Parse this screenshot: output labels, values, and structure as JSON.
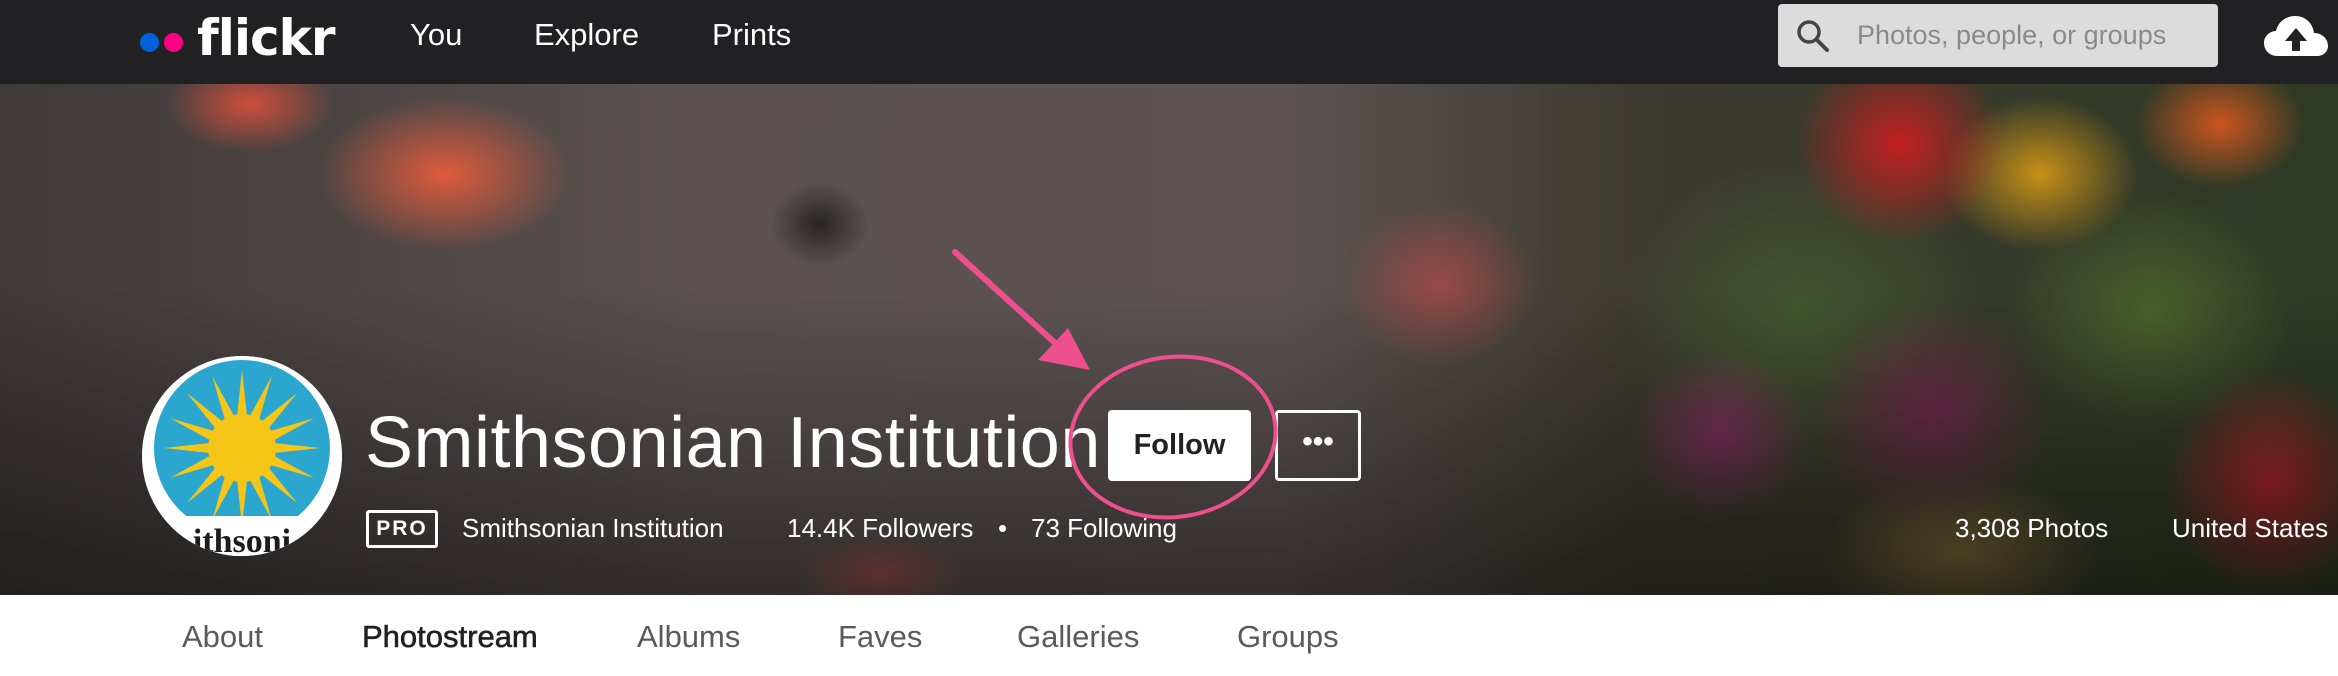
{
  "nav": {
    "logo_text": "flickr",
    "links": [
      "You",
      "Explore",
      "Prints"
    ],
    "search_placeholder": "Photos, people, or groups",
    "colors": {
      "bar": "#212124",
      "logo_blue": "#0063dc",
      "logo_pink": "#ff0084"
    },
    "icons": [
      "search-icon",
      "upload-cloud-icon"
    ]
  },
  "profile": {
    "name": "Smithsonian Institution",
    "follow_label": "Follow",
    "more_label": "•••",
    "pro_badge": "PRO",
    "real_name": "Smithsonian Institution",
    "followers": "14.4K Followers",
    "separator": "•",
    "following": "73 Following",
    "photos": "3,308 Photos",
    "location": "United States",
    "avatar_text": "ithsoni",
    "annotation_color": "#ee4f8f"
  },
  "tabs": {
    "items": [
      "About",
      "Photostream",
      "Albums",
      "Faves",
      "Galleries",
      "Groups"
    ],
    "active": "Photostream"
  }
}
